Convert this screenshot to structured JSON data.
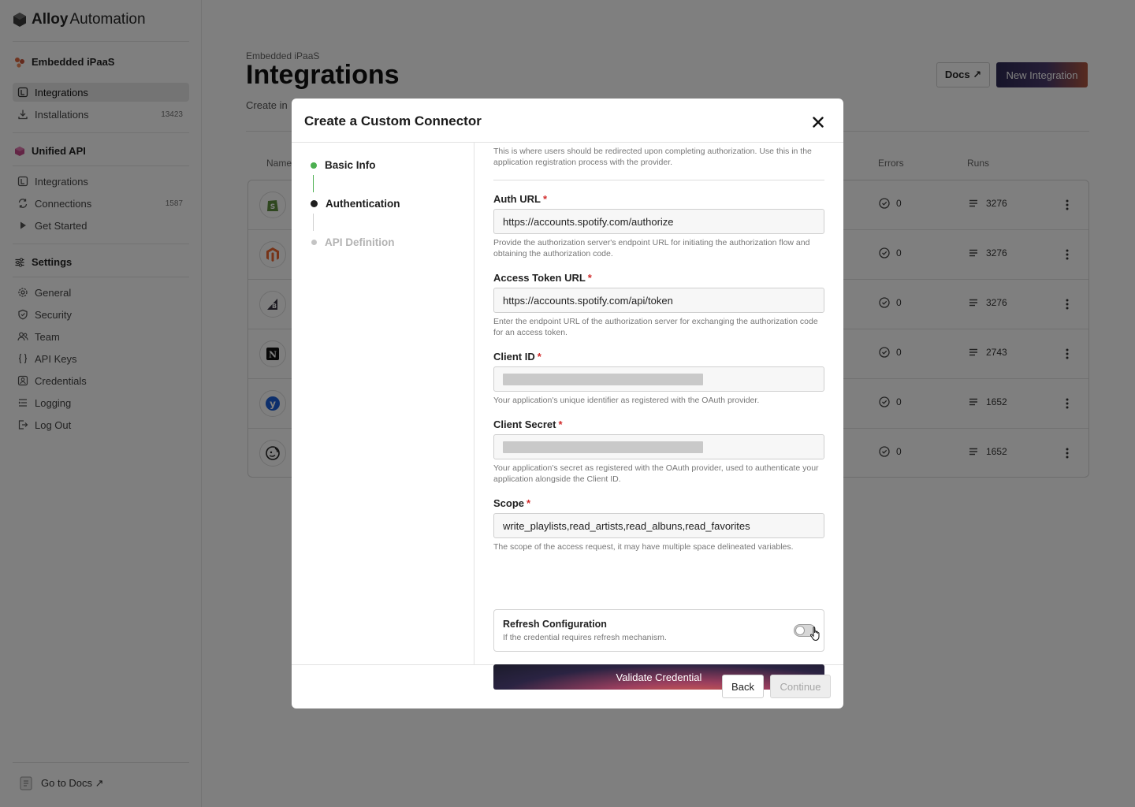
{
  "app": {
    "brand_bold": "Alloy",
    "brand_rest": "Automation"
  },
  "sidebar": {
    "sections": [
      {
        "label": "Embedded iPaaS",
        "items": [
          {
            "label": "Integrations",
            "icon": "integrations-icon",
            "active": true
          },
          {
            "label": "Installations",
            "icon": "download-icon",
            "count": "13423"
          }
        ]
      },
      {
        "label": "Unified API",
        "items": [
          {
            "label": "Integrations",
            "icon": "integrations-icon"
          },
          {
            "label": "Connections",
            "icon": "refresh-icon",
            "count": "1587"
          },
          {
            "label": "Get Started",
            "icon": "play-icon"
          }
        ]
      },
      {
        "label": "Settings",
        "items": [
          {
            "label": "General",
            "icon": "gear-icon"
          },
          {
            "label": "Security",
            "icon": "shield-icon"
          },
          {
            "label": "Team",
            "icon": "team-icon"
          },
          {
            "label": "API Keys",
            "icon": "braces-icon"
          },
          {
            "label": "Credentials",
            "icon": "credentials-icon"
          },
          {
            "label": "Logging",
            "icon": "logging-icon"
          },
          {
            "label": "Log Out",
            "icon": "logout-icon"
          }
        ]
      }
    ],
    "footer": {
      "label": "Go to Docs ↗",
      "icon": "doc-icon"
    }
  },
  "page": {
    "eyebrow": "Embedded iPaaS",
    "title": "Integrations",
    "subtitle": "Create in",
    "docs_button": "Docs ↗",
    "new_button": "New Integration",
    "columns": {
      "name": "Name",
      "errors": "Errors",
      "runs": "Runs"
    },
    "rows": [
      {
        "app": "shopify",
        "errors": "0",
        "runs": "3276"
      },
      {
        "app": "magento",
        "errors": "0",
        "runs": "3276"
      },
      {
        "app": "bigcommerce",
        "errors": "0",
        "runs": "3276"
      },
      {
        "app": "notion",
        "errors": "0",
        "runs": "2743"
      },
      {
        "app": "yotpo",
        "errors": "0",
        "runs": "1652"
      },
      {
        "app": "mailchimp",
        "errors": "0",
        "runs": "1652"
      }
    ]
  },
  "modal": {
    "title": "Create a Custom Connector",
    "steps": [
      {
        "label": "Basic Info",
        "state": "complete"
      },
      {
        "label": "Authentication",
        "state": "current"
      },
      {
        "label": "API Definition",
        "state": "pending"
      }
    ],
    "top_help": "This is where users should be redirected upon completing authorization. Use this in the application registration process with the provider.",
    "fields": {
      "auth_url": {
        "label": "Auth URL",
        "value": "https://accounts.spotify.com/authorize",
        "help": "Provide the authorization server's endpoint URL for initiating the authorization flow and obtaining the authorization code."
      },
      "token_url": {
        "label": "Access Token URL",
        "value": "https://accounts.spotify.com/api/token",
        "help": "Enter the endpoint URL of the authorization server for exchanging the authorization code for an access token."
      },
      "client_id": {
        "label": "Client ID",
        "help": "Your application's unique identifier as registered with the OAuth provider."
      },
      "client_secret": {
        "label": "Client Secret",
        "help": "Your application's secret as registered with the OAuth provider, used to authenticate your application alongside the Client ID."
      },
      "scope": {
        "label": "Scope",
        "value": "write_playlists,read_artists,read_albuns,read_favorites",
        "help": "The scope of the access request, it may have multiple space delineated variables."
      }
    },
    "required_mark": "*",
    "refresh": {
      "title": "Refresh Configuration",
      "help": "If the credential requires refresh mechanism.",
      "enabled": false
    },
    "validate_button": "Validate Credential",
    "back_button": "Back",
    "continue_button": "Continue"
  },
  "colors": {
    "step_complete": "#4caf50",
    "step_current": "#1f1f1f",
    "step_pending": "#c4c4c4",
    "required": "#d12b2b"
  }
}
